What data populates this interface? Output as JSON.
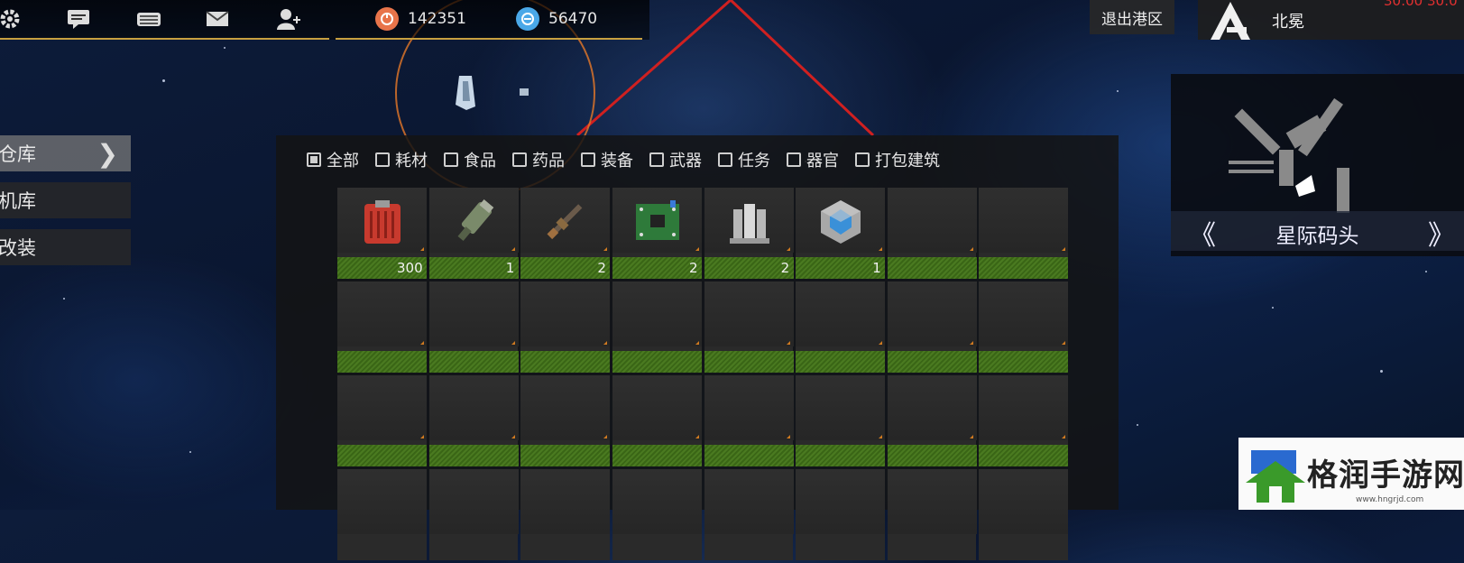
{
  "topbar": {
    "icons": [
      "gear-icon",
      "chat-icon",
      "keyboard-icon",
      "mail-icon",
      "add-friend-icon"
    ],
    "resources": [
      {
        "icon": "orange-coin-icon",
        "value": "142351",
        "color": "#e8744a"
      },
      {
        "icon": "blue-credit-icon",
        "value": "56470",
        "color": "#4aa8e8"
      }
    ]
  },
  "left_menu": {
    "items": [
      {
        "label": "仓库",
        "active": true
      },
      {
        "label": "机库",
        "active": false
      },
      {
        "label": "改装",
        "active": false
      }
    ]
  },
  "inventory": {
    "filters": [
      {
        "label": "全部",
        "checked": true
      },
      {
        "label": "耗材",
        "checked": false
      },
      {
        "label": "食品",
        "checked": false
      },
      {
        "label": "药品",
        "checked": false
      },
      {
        "label": "装备",
        "checked": false
      },
      {
        "label": "武器",
        "checked": false
      },
      {
        "label": "任务",
        "checked": false
      },
      {
        "label": "器官",
        "checked": false
      },
      {
        "label": "打包建筑",
        "checked": false
      }
    ],
    "row1": [
      {
        "item": "red-canister-icon",
        "count": "300"
      },
      {
        "item": "gatling-gun-icon",
        "count": "1"
      },
      {
        "item": "rifle-icon",
        "count": "2"
      },
      {
        "item": "circuit-board-icon",
        "count": "2"
      },
      {
        "item": "metal-plates-icon",
        "count": "2"
      },
      {
        "item": "crystal-cube-icon",
        "count": "1"
      },
      {
        "item": "",
        "count": ""
      },
      {
        "item": "",
        "count": ""
      }
    ]
  },
  "header_right": {
    "exit_label": "退出港区",
    "location_name": "北冕",
    "timer": "30:00 30:0"
  },
  "map": {
    "station_label": "星际码头",
    "prev": "《",
    "next": "》"
  },
  "watermark": {
    "brand": "格润手游网",
    "url": "www.hngrjd.com"
  },
  "colors": {
    "accent_gold": "#c8a040",
    "slot_bar_green": "#4a7a20",
    "radar_orange": "#e67828",
    "laser_red": "#d02020"
  }
}
